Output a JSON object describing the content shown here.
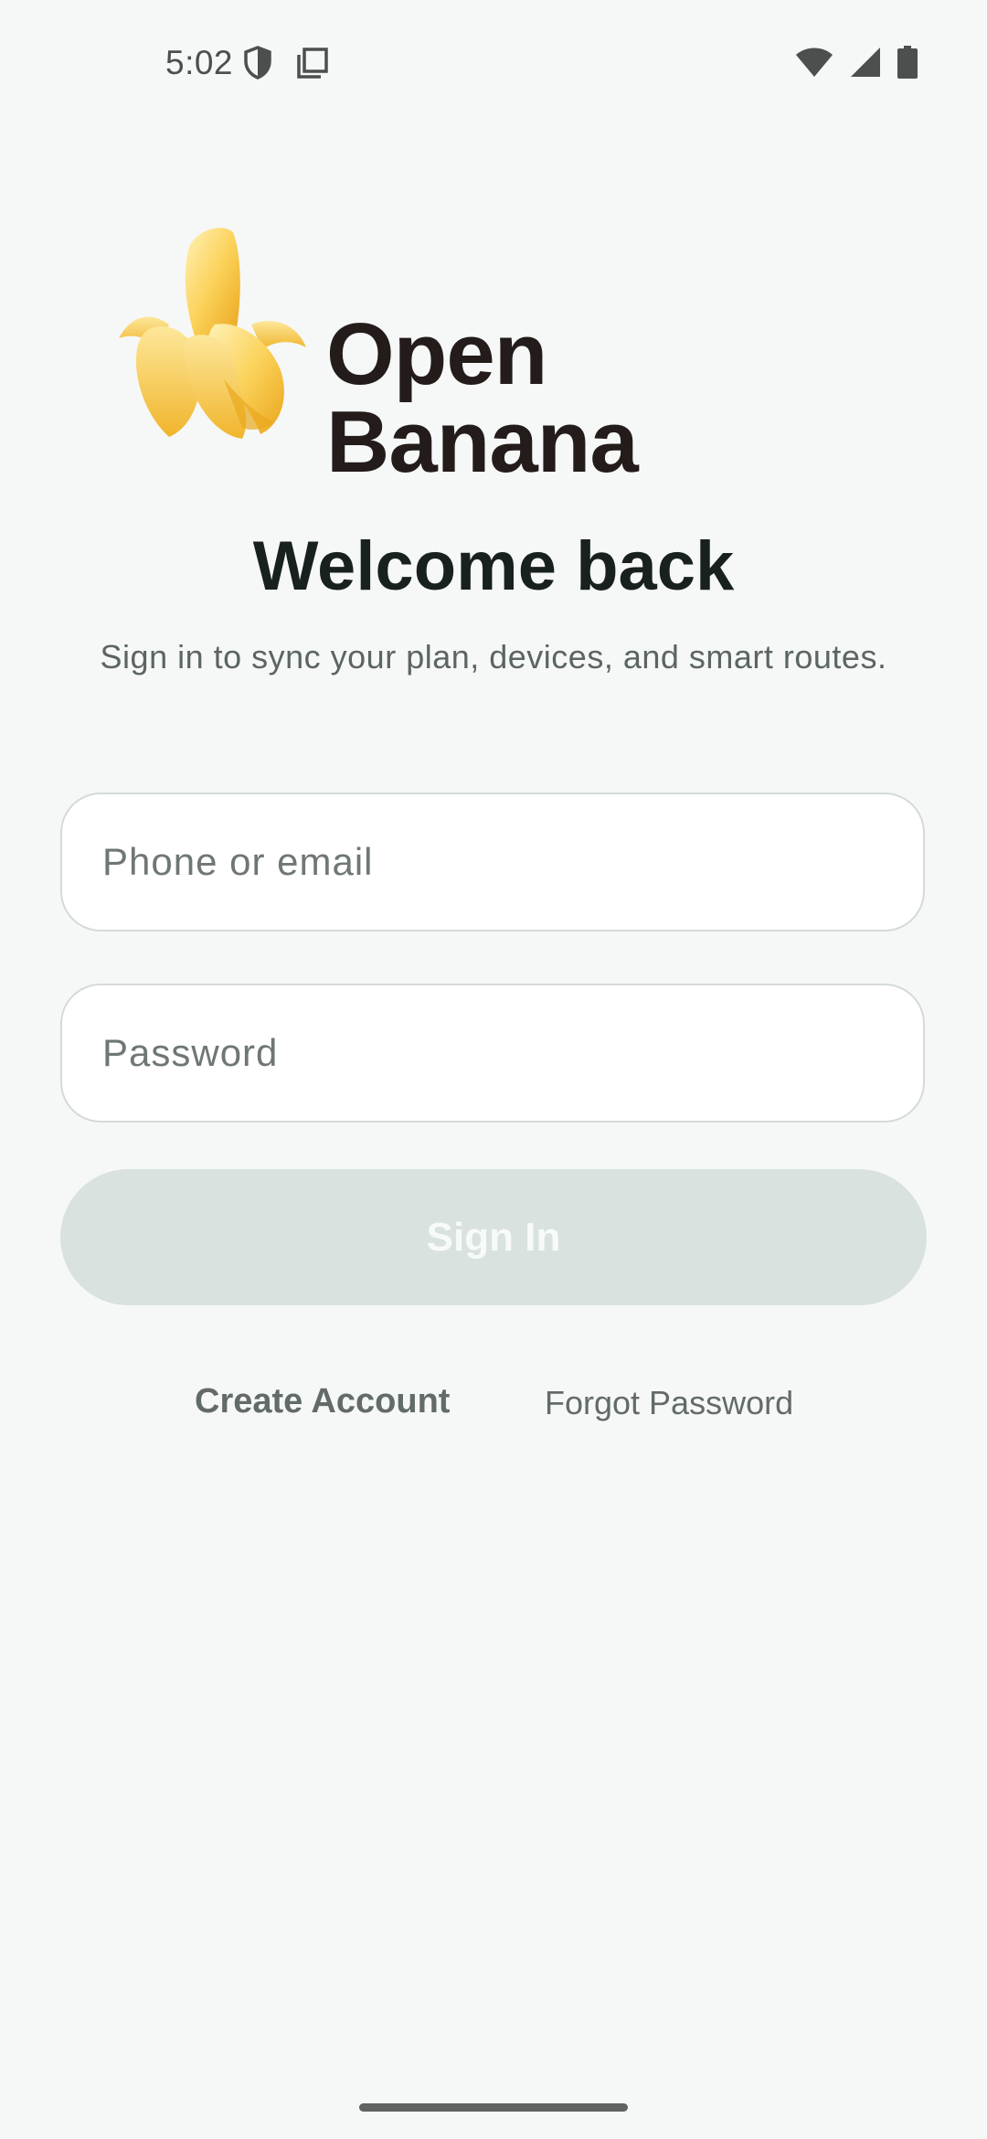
{
  "status_bar": {
    "time": "5:02",
    "left_icons": [
      "shield-icon",
      "copy-icon"
    ],
    "right_icons": [
      "wifi-icon",
      "signal-icon",
      "battery-icon"
    ]
  },
  "brand": {
    "name": "Open Banana",
    "logo_icon": "banana-icon",
    "colors": {
      "banana_light": "#fce28c",
      "banana_mid": "#f7c544",
      "banana_dark": "#e9a81c",
      "wordmark": "#231c1a"
    }
  },
  "header": {
    "title": "Welcome back",
    "subtitle": "Sign in to sync your plan, devices, and smart routes."
  },
  "form": {
    "phone_placeholder": "Phone or email",
    "phone_value": "",
    "password_placeholder": "Password",
    "password_value": "",
    "signin_label": "Sign In",
    "signin_enabled": false
  },
  "links": {
    "create_account": "Create Account",
    "forgot_password": "Forgot Password"
  },
  "colors": {
    "background": "#f6f8f7",
    "button_disabled": "#d9e2df",
    "field_border": "#d4dad8",
    "link_text": "#626b68"
  }
}
